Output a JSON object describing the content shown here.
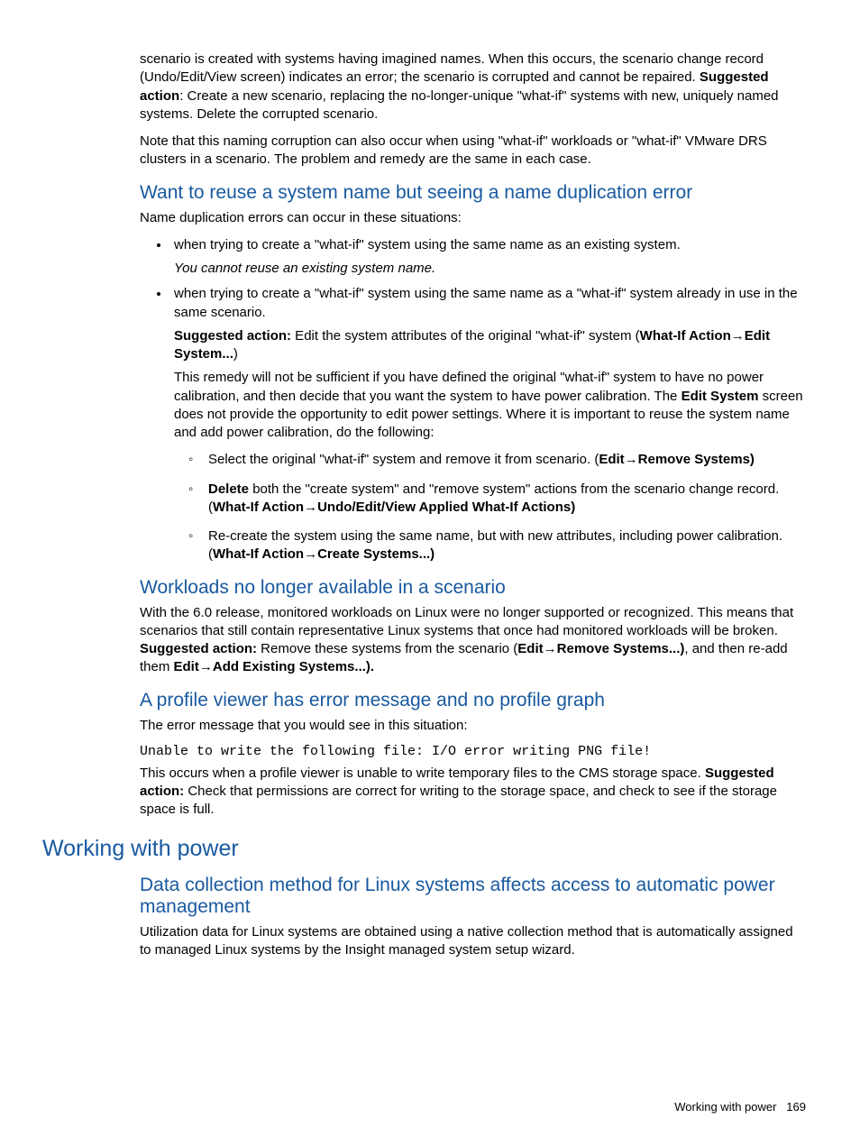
{
  "intro1": "scenario is created with systems having imagined names. When this occurs, the scenario change record (Undo/Edit/View screen) indicates an error; the scenario is corrupted and cannot be repaired. ",
  "intro1_bold": "Suggested action",
  "intro1_after": ": Create a new scenario, replacing the no-longer-unique \"what-if\" systems with new, uniquely named systems. Delete the corrupted scenario.",
  "intro2": "Note that this naming corruption can also occur when using \"what-if\" workloads or \"what-if\" VMware DRS clusters in a scenario. The problem and remedy are the same in each case.",
  "s1": {
    "title": "Want to reuse a system name but seeing a name duplication error",
    "lead": "Name duplication errors can occur in these situations:",
    "b1": "when trying to create a \"what-if\" system using the same name as an existing system.",
    "b1_note": "You cannot reuse an existing system name.",
    "b2": "when trying to create a \"what-if\" system using the same name as a \"what-if\" system already in use in the same scenario.",
    "b2_s_label": "Suggested action:",
    "b2_s_text": " Edit the system attributes of the original \"what-if\" system (",
    "b2_s_path1": "What-If Action",
    "b2_s_path2": "Edit System...",
    "b2_close": ")",
    "b2_p2_a": "This remedy will not be sufficient if you have defined the original \"what-if\" system to have no power calibration, and then decide that you want the system to have power calibration. The ",
    "b2_p2_bold": "Edit System",
    "b2_p2_b": " screen does not provide the opportunity to edit power settings. Where it is important to reuse the system name and add power calibration, do the following:",
    "c1_a": "Select the original \"what-if\" system and remove it from scenario. (",
    "c1_bold1": "Edit",
    "c1_bold2": "Remove Systems)",
    "c2_bold": "Delete",
    "c2_a": " both the \"create system\" and \"remove system\" actions from the scenario change record. (",
    "c2_bold2": "What-If Action",
    "c2_bold3": "Undo/Edit/View Applied What-If Actions)",
    "c3_a": "Re-create the system using the same name, but with new attributes, including power calibration. (",
    "c3_bold1": "What-If Action",
    "c3_bold2": "Create Systems...)"
  },
  "s2": {
    "title": "Workloads no longer available in a scenario",
    "p_a": "With the 6.0 release, monitored workloads on Linux were no longer supported or recognized. This means that scenarios that still contain representative Linux systems that once had monitored workloads will be broken. ",
    "p_bold1": "Suggested action:",
    "p_b": " Remove these systems from the scenario (",
    "p_bold2": "Edit",
    "p_bold3": "Remove Systems...)",
    "p_c": ", and then re-add them ",
    "p_bold4": "Edit",
    "p_bold5": "Add Existing Systems...)."
  },
  "s3": {
    "title": "A profile viewer has error message and no profile graph",
    "p1": "The error message that you would see in this situation:",
    "code": "Unable to write the following file: I/O error writing PNG file!",
    "p2_a": "This occurs when a profile viewer is unable to write temporary files to the CMS storage space. ",
    "p2_bold": "Suggested action:",
    "p2_b": " Check that permissions are correct for writing to the storage space, and check to see if the storage space is full."
  },
  "s4": {
    "title": "Working with power",
    "sub": "Data collection method for Linux systems affects access to automatic power management",
    "p": "Utilization data for Linux systems are obtained using a native collection method that is automatically assigned to managed Linux systems by the Insight managed system setup wizard."
  },
  "footer": {
    "label": "Working with power",
    "page": "169"
  },
  "arrow": "→"
}
